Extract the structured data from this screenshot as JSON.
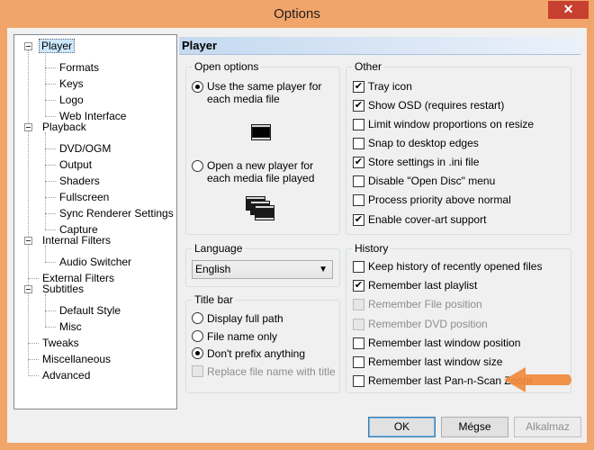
{
  "window": {
    "title": "Options",
    "close_glyph": "✕"
  },
  "tree": {
    "items": [
      {
        "label": "Player",
        "selected": true
      },
      {
        "label": "Formats"
      },
      {
        "label": "Keys"
      },
      {
        "label": "Logo"
      },
      {
        "label": "Web Interface"
      },
      {
        "label": "Playback"
      },
      {
        "label": "DVD/OGM"
      },
      {
        "label": "Output"
      },
      {
        "label": "Shaders"
      },
      {
        "label": "Fullscreen"
      },
      {
        "label": "Sync Renderer Settings"
      },
      {
        "label": "Capture"
      },
      {
        "label": "Internal Filters"
      },
      {
        "label": "Audio Switcher"
      },
      {
        "label": "External Filters"
      },
      {
        "label": "Subtitles"
      },
      {
        "label": "Default Style"
      },
      {
        "label": "Misc"
      },
      {
        "label": "Tweaks"
      },
      {
        "label": "Miscellaneous"
      },
      {
        "label": "Advanced"
      }
    ]
  },
  "page": {
    "header": "Player"
  },
  "open_options": {
    "title": "Open options",
    "same_player": "Use the same player for each media file",
    "new_player": "Open a new player for each media file played",
    "selected": "same_player"
  },
  "language": {
    "title": "Language",
    "value": "English"
  },
  "title_bar": {
    "title": "Title bar",
    "full_path": "Display full path",
    "file_name_only": "File name only",
    "dont_prefix": "Don't prefix anything",
    "replace_file_name": "Replace file name with title",
    "selected": "dont_prefix"
  },
  "other": {
    "title": "Other",
    "items": [
      {
        "label": "Tray icon",
        "checked": true
      },
      {
        "label": "Show OSD (requires restart)",
        "checked": true
      },
      {
        "label": "Limit window proportions on resize",
        "checked": false
      },
      {
        "label": "Snap to desktop edges",
        "checked": false
      },
      {
        "label": "Store settings in .ini file",
        "checked": true
      },
      {
        "label": "Disable \"Open Disc\" menu",
        "checked": false
      },
      {
        "label": "Process priority above normal",
        "checked": false
      },
      {
        "label": "Enable cover-art support",
        "checked": true
      }
    ]
  },
  "history": {
    "title": "History",
    "items": [
      {
        "label": "Keep history of recently opened files",
        "checked": false,
        "disabled": false
      },
      {
        "label": "Remember last playlist",
        "checked": true,
        "disabled": false
      },
      {
        "label": "Remember File position",
        "checked": false,
        "disabled": true
      },
      {
        "label": "Remember DVD position",
        "checked": false,
        "disabled": true
      },
      {
        "label": "Remember last window position",
        "checked": false,
        "disabled": false
      },
      {
        "label": "Remember last window size",
        "checked": false,
        "disabled": false
      },
      {
        "label": "Remember last Pan-n-Scan Zoom",
        "checked": false,
        "disabled": false
      }
    ]
  },
  "buttons": {
    "ok": "OK",
    "cancel": "Mégse",
    "apply": "Alkalmaz"
  },
  "colors": {
    "frame": "#f2a56a",
    "accent_arrow": "#f08a3c",
    "selection": "#cce8ff"
  }
}
